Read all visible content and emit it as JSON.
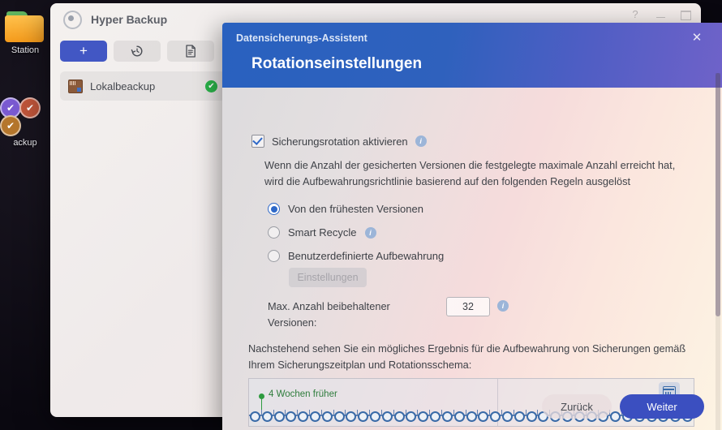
{
  "desktop": {
    "icons": [
      {
        "name": "folder-station",
        "label": "Station"
      },
      {
        "name": "backup-badges",
        "label": "ackup"
      }
    ]
  },
  "hyper_backup_window": {
    "title": "Hyper Backup",
    "window_controls": {
      "help": "?",
      "minimize": "",
      "maximize": ""
    },
    "toolbar": [
      {
        "name": "add-backup-button",
        "glyph": "+"
      },
      {
        "name": "restore-button",
        "glyph": "↺"
      },
      {
        "name": "log-button",
        "glyph": "🗎"
      }
    ],
    "backup_list": [
      {
        "label": "Lokalbeackup",
        "status": "✔"
      }
    ]
  },
  "dialog": {
    "subtitle": "Datensicherungs-Assistent",
    "title": "Rotationseinstellungen",
    "close_label": "✕",
    "enable_rotation": {
      "label": "Sicherungsrotation aktivieren",
      "checked": true,
      "info": "i"
    },
    "description_1": "Wenn die Anzahl der gesicherten Versionen die festgelegte maximale Anzahl erreicht hat, wird die Aufbewahrungsrichtlinie basierend auf den folgenden Regeln ausgelöst",
    "radio_options": [
      {
        "label": "Von den frühesten Versionen",
        "selected": true,
        "info": null
      },
      {
        "label": "Smart Recycle",
        "selected": false,
        "info": "i"
      },
      {
        "label": "Benutzerdefinierte Aufbewahrung",
        "selected": false,
        "info": null
      }
    ],
    "settings_button": "Einstellungen",
    "max_versions": {
      "label": "Max. Anzahl beibehaltener Versionen:",
      "value": "32",
      "info": "i"
    },
    "description_2": "Nachstehend sehen Sie ein mögliches Ergebnis für die Aufbewahrung von Sicherungen gemäß Ihrem Sicherungszeitplan und Rotationsschema:",
    "timeline": {
      "marker_label": "4 Wochen früher",
      "marker_color": "#2e9b3f",
      "dot_count": 37,
      "calendar_icon": "calendar-icon"
    },
    "footer": {
      "back_label": "Zurück",
      "next_label": "Weiter",
      "next_color": "#3b4fc0"
    }
  }
}
